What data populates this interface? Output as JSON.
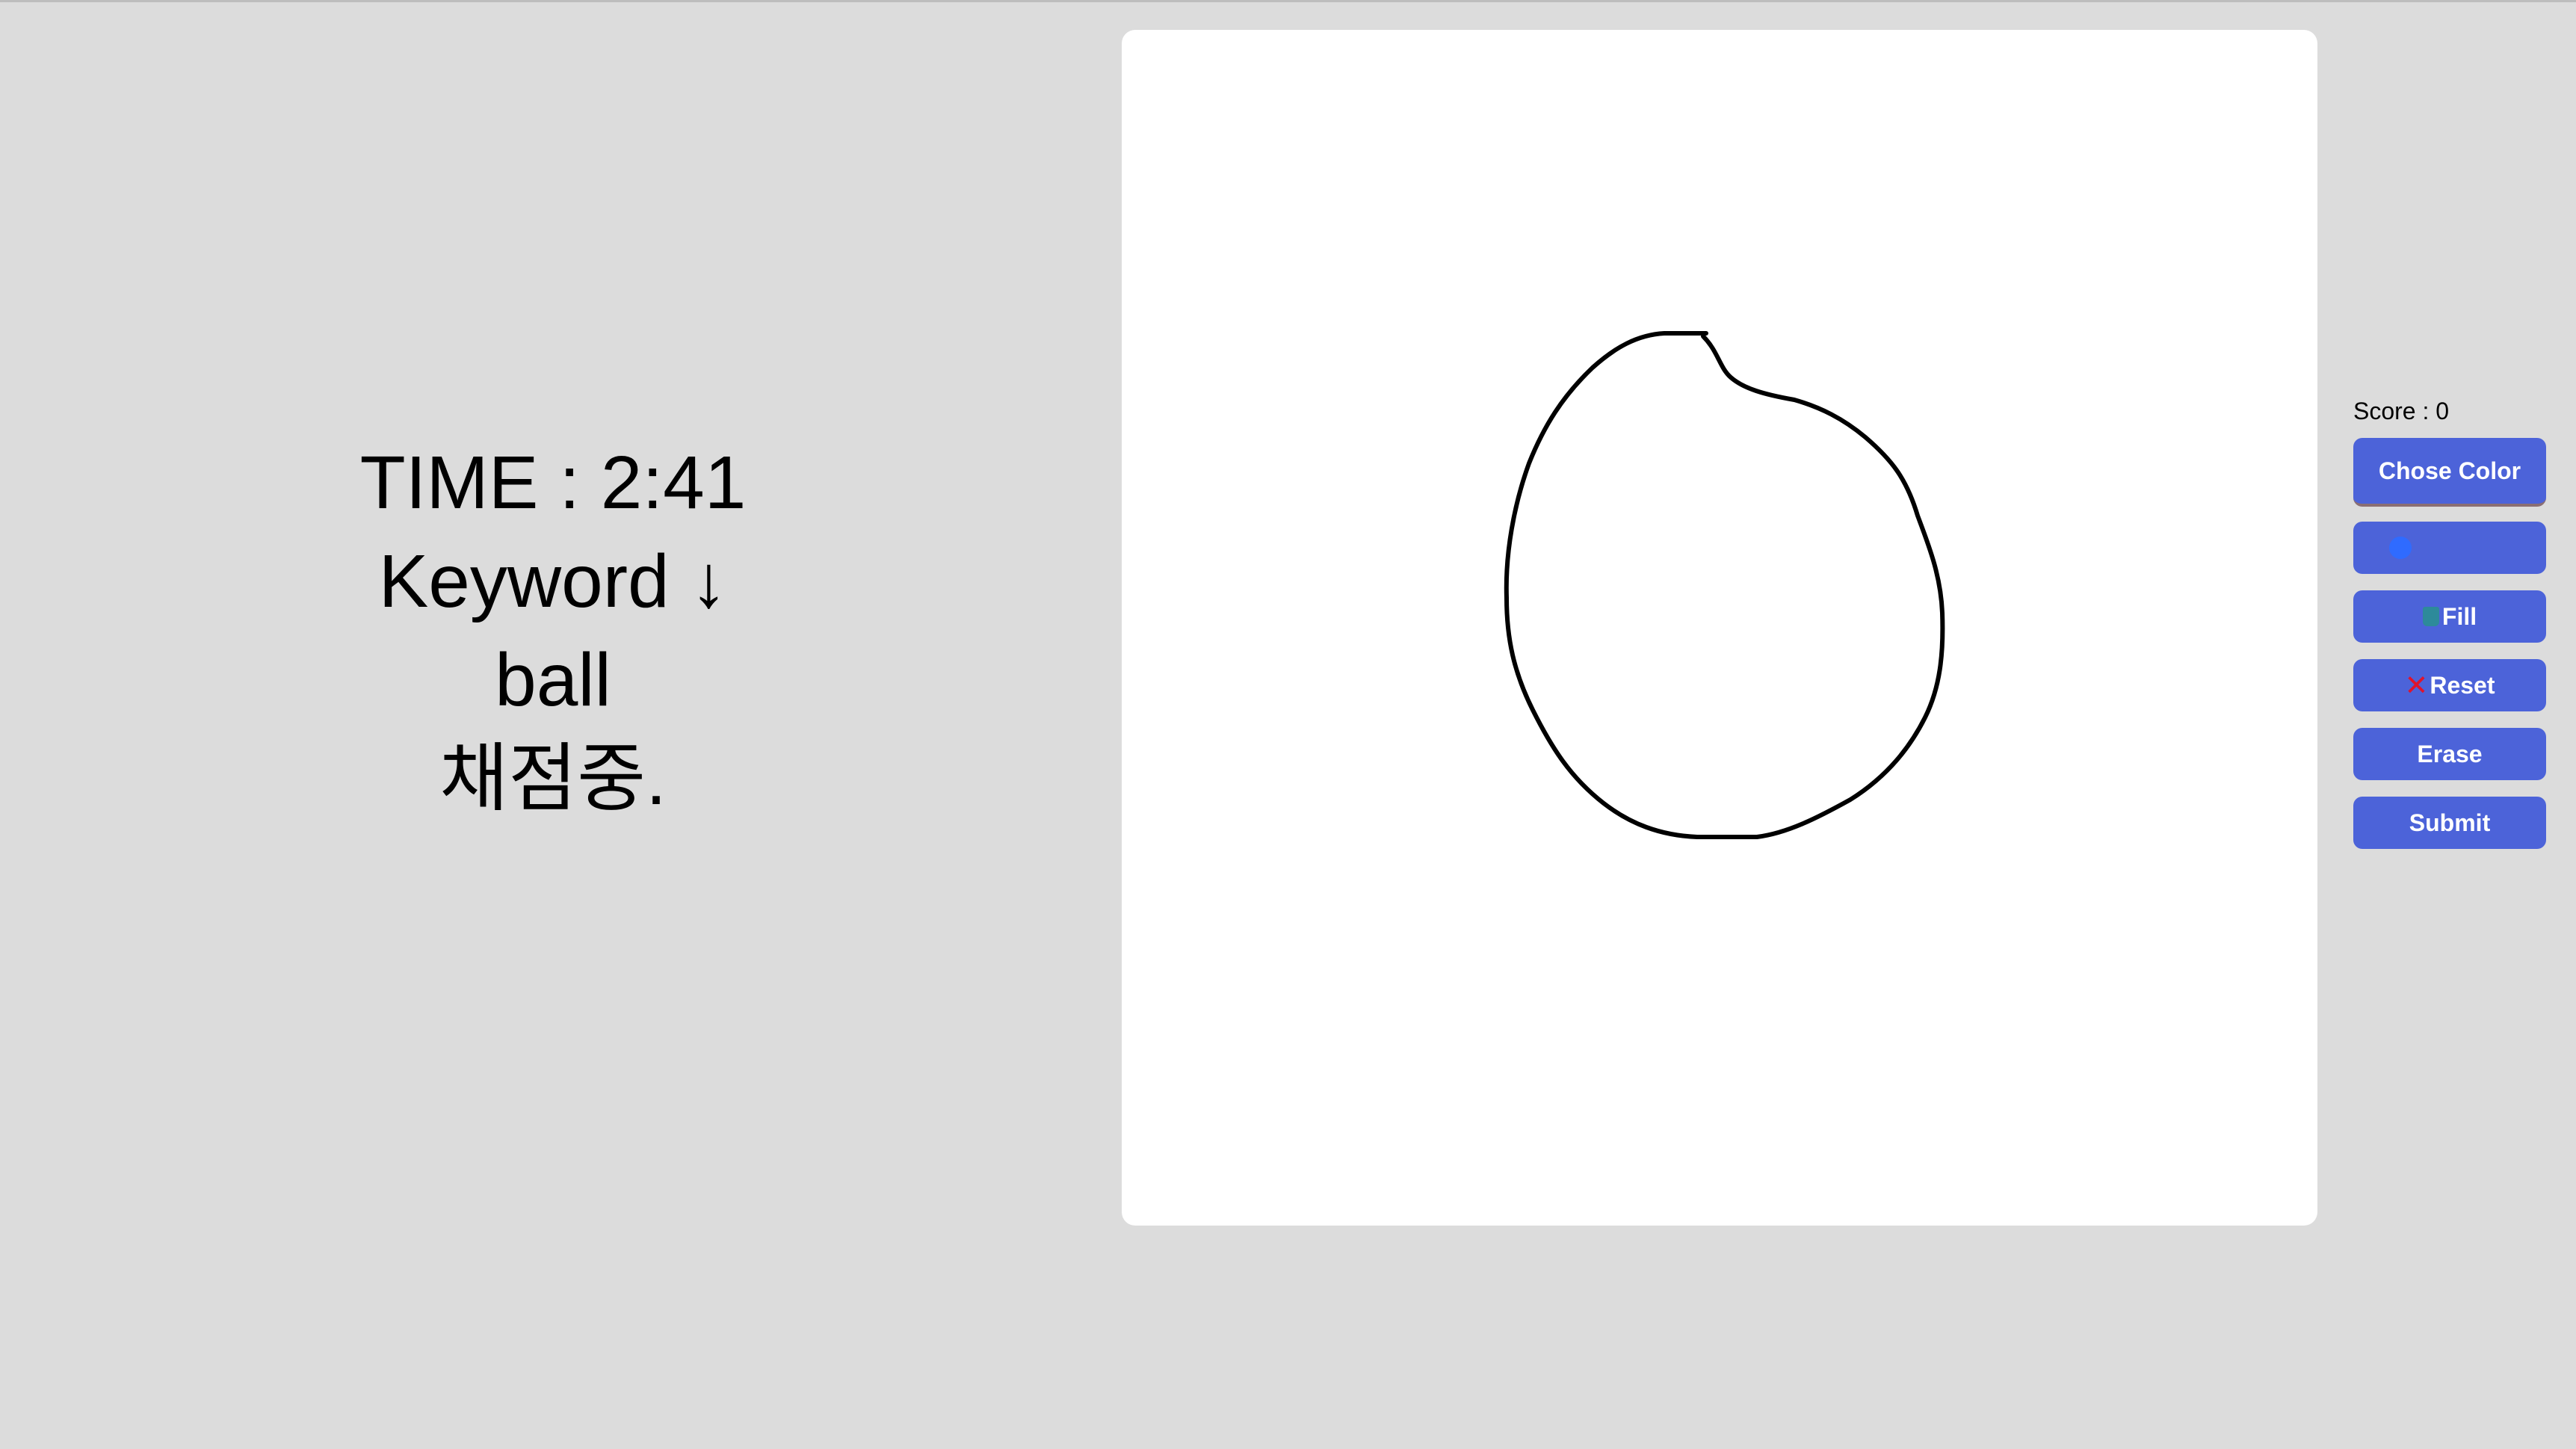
{
  "game": {
    "time_label": "TIME : 2:41",
    "keyword_label": "Keyword ↓",
    "keyword": "ball",
    "status": "채점중."
  },
  "toolbar": {
    "score_label": "Score : 0",
    "choose_color_label": "Chose Color",
    "selected_color": "#2f6bff",
    "fill_label": "Fill",
    "reset_label": "Reset",
    "erase_label": "Erase",
    "submit_label": "Submit"
  },
  "icons": {
    "fill": "paint-bucket-icon",
    "reset": "close-icon"
  },
  "colors": {
    "background": "#dcdcdc",
    "button": "#4c63d9",
    "canvas": "#ffffff",
    "stroke": "#000000"
  }
}
